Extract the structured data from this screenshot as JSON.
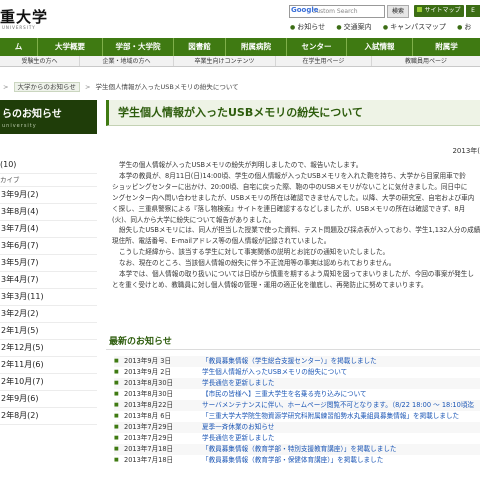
{
  "header": {
    "logo": "重大学",
    "logo_sub": "UNIVERSITY",
    "search_placeholder": "Custom Search",
    "search_google": "Google",
    "search_button": "検索",
    "sitemap": "サイトマップ",
    "sitemap_extra": "E",
    "quick_links": [
      "お知らせ",
      "交通案内",
      "キャンパスマップ",
      "お"
    ]
  },
  "gnav": [
    "ム",
    "大学概要",
    "学部・大学院",
    "図書館",
    "附属病院",
    "センター",
    "入試情報",
    "附属学"
  ],
  "subnav": [
    "受験生の方へ",
    "企業・地域の方へ",
    "卒業生向けコンテンツ",
    "在学生用ページ",
    "教職員用ページ"
  ],
  "breadcrumb": [
    "",
    ">",
    "大学からのお知らせ",
    ">",
    "学生個人情報が入ったUSBメモリの紛失について"
  ],
  "sidebar": {
    "title": "らのお知らせ",
    "subtitle": "university",
    "count": "(10)",
    "archive_label": "カイブ",
    "months": [
      "3年9月(2)",
      "3年8月(4)",
      "3年7月(4)",
      "3年6月(7)",
      "3年5月(7)",
      "3年4月(7)",
      "3年3月(11)",
      "3年2月(2)",
      "2年1月(5)",
      "2年12月(5)",
      "2年11月(6)",
      "2年10月(7)",
      "2年9月(6)",
      "2年8月(2)"
    ]
  },
  "main": {
    "title": "学生個人情報が入ったUSBメモリの紛失について",
    "date": "2013年(",
    "body": [
      "学生の個人情報が入ったUSBメモリの紛失が判明しましたので、報告いたします。",
      "本学の教員が、8月11日(日)14:00頃、学生の個人情報が入ったUSBメモリを入れた鞄を持ち、大学から目家用車で鈴",
      "ショッピングセンターに出かけ、20:00頃、自宅に戻った際、鞄の中のUSBメモリがないことに気付きました。同日中に",
      "ングセンター内へ問い合わせましたが、USBメモリの所在は確認できませんでした。以降、大学の研究室、自宅および車内",
      "く探し、三重県警察による『落し物検索』サイトを連日確認するなどしましたが、USBメモリの所在は確認できず、8月",
      "(火)、同人から大学に紛失について報告がありました。",
      "紛失したUSBメモリには、同人が担当した授業で使った資料、テスト問題及び採点表が入っており、学生1,132人分の成績、学生10",
      "現住所、電話番号、E-mailアドレス等の個人情報が記録されていました。",
      "こうした経緯から、該当する学生に対して事実関係の説明とお詫びの通知をいたしました。",
      "なお、現在のところ、当該個人情報の紛失に伴う不正流用等の事実は認められておりません。",
      "本学では、個人情報の取り扱いについては日頃から慎重を期するよう周知を図ってまいりましたが、今回の事案が発生し",
      "とを重く受けとめ、教職員に対し個人情報の管理・運用の適正化を徹底し、再発防止に努めてまいります。"
    ]
  },
  "latest": {
    "heading": "最新のお知らせ",
    "items": [
      {
        "date": "2013年9月 3日",
        "title": "「教員募集情報（学生総合支援センター）」を掲載しました"
      },
      {
        "date": "2013年9月 2日",
        "title": "学生個人情報が入ったUSBメモリの紛失について"
      },
      {
        "date": "2013年8月30日",
        "title": "学長通信を更新しました"
      },
      {
        "date": "2013年8月30日",
        "title": "【市民の皆様へ】三重大学生を名乗る売り込みについて"
      },
      {
        "date": "2013年8月22日",
        "title": "サーバメンテナンスに伴い、ホームページ閲覧不可となります。（8/22 18:00 ～ 18:10頃迄"
      },
      {
        "date": "2013年8月 6日",
        "title": "「三重大学大学院生物資源学研究科附属練習船勢水丸乗組員募集情報」を掲載しました"
      },
      {
        "date": "2013年7月29日",
        "title": "夏季一斉休業のお知らせ"
      },
      {
        "date": "2013年7月29日",
        "title": "学長通信を更新しました"
      },
      {
        "date": "2013年7月18日",
        "title": "「教員募集情報（教育学部・特別支援教育講座）」を掲載しました"
      },
      {
        "date": "2013年7月18日",
        "title": "「教員募集情報（教育学部・保健体育講座）」を掲載しました"
      }
    ]
  }
}
